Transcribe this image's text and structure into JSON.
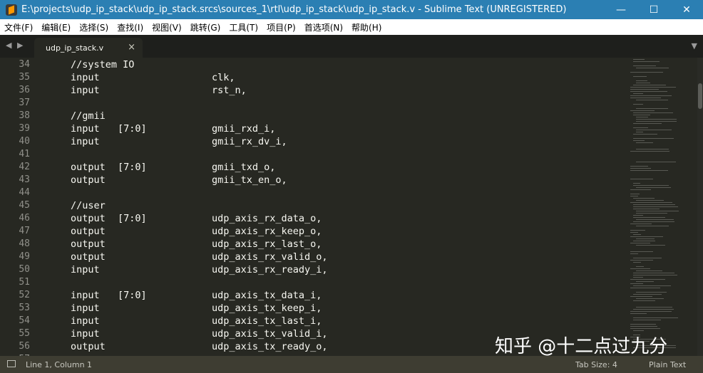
{
  "window": {
    "title": "E:\\projects\\udp_ip_stack\\udp_ip_stack.srcs\\sources_1\\rtl\\udp_ip_stack\\udp_ip_stack.v - Sublime Text (UNREGISTERED)",
    "controls": {
      "minimize": "—",
      "maximize": "☐",
      "close": "✕"
    }
  },
  "menu": [
    "文件(F)",
    "编辑(E)",
    "选择(S)",
    "查找(I)",
    "视图(V)",
    "跳转(G)",
    "工具(T)",
    "项目(P)",
    "首选项(N)",
    "帮助(H)"
  ],
  "tabs": {
    "nav_arrows": "◀ ▶",
    "active": {
      "label": "udp_ip_stack.v",
      "close": "×"
    },
    "dropdown": "▼"
  },
  "editor": {
    "lines": [
      {
        "num": "34",
        "a": "//system IO",
        "b": "",
        "c": "",
        "comment": true
      },
      {
        "num": "35",
        "a": "input",
        "b": "",
        "c": "clk,"
      },
      {
        "num": "36",
        "a": "input",
        "b": "",
        "c": "rst_n,"
      },
      {
        "num": "37",
        "a": "",
        "b": "",
        "c": ""
      },
      {
        "num": "38",
        "a": "//gmii",
        "b": "",
        "c": "",
        "comment": true
      },
      {
        "num": "39",
        "a": "input",
        "b": "[7:0]",
        "c": "gmii_rxd_i,"
      },
      {
        "num": "40",
        "a": "input",
        "b": "",
        "c": "gmii_rx_dv_i,"
      },
      {
        "num": "41",
        "a": "",
        "b": "",
        "c": ""
      },
      {
        "num": "42",
        "a": "output",
        "b": "[7:0]",
        "c": "gmii_txd_o,"
      },
      {
        "num": "43",
        "a": "output",
        "b": "",
        "c": "gmii_tx_en_o,"
      },
      {
        "num": "44",
        "a": "",
        "b": "",
        "c": ""
      },
      {
        "num": "45",
        "a": "//user",
        "b": "",
        "c": "",
        "comment": true
      },
      {
        "num": "46",
        "a": "output",
        "b": "[7:0]",
        "c": "udp_axis_rx_data_o,"
      },
      {
        "num": "47",
        "a": "output",
        "b": "",
        "c": "udp_axis_rx_keep_o,"
      },
      {
        "num": "48",
        "a": "output",
        "b": "",
        "c": "udp_axis_rx_last_o,"
      },
      {
        "num": "49",
        "a": "output",
        "b": "",
        "c": "udp_axis_rx_valid_o,"
      },
      {
        "num": "50",
        "a": "input",
        "b": "",
        "c": "udp_axis_rx_ready_i,"
      },
      {
        "num": "51",
        "a": "",
        "b": "",
        "c": ""
      },
      {
        "num": "52",
        "a": "input",
        "b": "[7:0]",
        "c": "udp_axis_tx_data_i,"
      },
      {
        "num": "53",
        "a": "input",
        "b": "",
        "c": "udp_axis_tx_keep_i,"
      },
      {
        "num": "54",
        "a": "input",
        "b": "",
        "c": "udp_axis_tx_last_i,"
      },
      {
        "num": "55",
        "a": "input",
        "b": "",
        "c": "udp_axis_tx_valid_i,"
      },
      {
        "num": "56",
        "a": "output",
        "b": "",
        "c": "udp_axis_tx_ready_o,"
      },
      {
        "num": "57",
        "a": "",
        "b": "",
        "c": ""
      }
    ]
  },
  "status": {
    "position": "Line 1, Column 1",
    "tab_size": "Tab Size: 4",
    "syntax": "Plain Text"
  },
  "watermark": "知乎 @十二点过九分",
  "colors": {
    "titlebar": "#2b7fb3",
    "editor_bg": "#272822",
    "text": "#f8f8f2",
    "line_numbers": "#90908a",
    "statusbar": "#3e3d32"
  }
}
